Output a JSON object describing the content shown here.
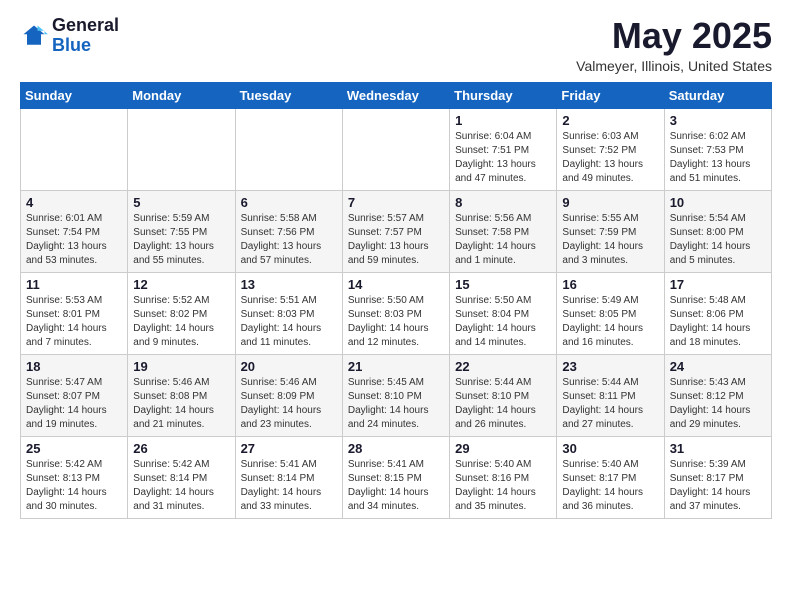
{
  "logo": {
    "general": "General",
    "blue": "Blue"
  },
  "title": "May 2025",
  "location": "Valmeyer, Illinois, United States",
  "days_header": [
    "Sunday",
    "Monday",
    "Tuesday",
    "Wednesday",
    "Thursday",
    "Friday",
    "Saturday"
  ],
  "weeks": [
    [
      {
        "num": "",
        "sunrise": "",
        "sunset": "",
        "daylight": ""
      },
      {
        "num": "",
        "sunrise": "",
        "sunset": "",
        "daylight": ""
      },
      {
        "num": "",
        "sunrise": "",
        "sunset": "",
        "daylight": ""
      },
      {
        "num": "",
        "sunrise": "",
        "sunset": "",
        "daylight": ""
      },
      {
        "num": "1",
        "sunrise": "Sunrise: 6:04 AM",
        "sunset": "Sunset: 7:51 PM",
        "daylight": "Daylight: 13 hours and 47 minutes."
      },
      {
        "num": "2",
        "sunrise": "Sunrise: 6:03 AM",
        "sunset": "Sunset: 7:52 PM",
        "daylight": "Daylight: 13 hours and 49 minutes."
      },
      {
        "num": "3",
        "sunrise": "Sunrise: 6:02 AM",
        "sunset": "Sunset: 7:53 PM",
        "daylight": "Daylight: 13 hours and 51 minutes."
      }
    ],
    [
      {
        "num": "4",
        "sunrise": "Sunrise: 6:01 AM",
        "sunset": "Sunset: 7:54 PM",
        "daylight": "Daylight: 13 hours and 53 minutes."
      },
      {
        "num": "5",
        "sunrise": "Sunrise: 5:59 AM",
        "sunset": "Sunset: 7:55 PM",
        "daylight": "Daylight: 13 hours and 55 minutes."
      },
      {
        "num": "6",
        "sunrise": "Sunrise: 5:58 AM",
        "sunset": "Sunset: 7:56 PM",
        "daylight": "Daylight: 13 hours and 57 minutes."
      },
      {
        "num": "7",
        "sunrise": "Sunrise: 5:57 AM",
        "sunset": "Sunset: 7:57 PM",
        "daylight": "Daylight: 13 hours and 59 minutes."
      },
      {
        "num": "8",
        "sunrise": "Sunrise: 5:56 AM",
        "sunset": "Sunset: 7:58 PM",
        "daylight": "Daylight: 14 hours and 1 minute."
      },
      {
        "num": "9",
        "sunrise": "Sunrise: 5:55 AM",
        "sunset": "Sunset: 7:59 PM",
        "daylight": "Daylight: 14 hours and 3 minutes."
      },
      {
        "num": "10",
        "sunrise": "Sunrise: 5:54 AM",
        "sunset": "Sunset: 8:00 PM",
        "daylight": "Daylight: 14 hours and 5 minutes."
      }
    ],
    [
      {
        "num": "11",
        "sunrise": "Sunrise: 5:53 AM",
        "sunset": "Sunset: 8:01 PM",
        "daylight": "Daylight: 14 hours and 7 minutes."
      },
      {
        "num": "12",
        "sunrise": "Sunrise: 5:52 AM",
        "sunset": "Sunset: 8:02 PM",
        "daylight": "Daylight: 14 hours and 9 minutes."
      },
      {
        "num": "13",
        "sunrise": "Sunrise: 5:51 AM",
        "sunset": "Sunset: 8:03 PM",
        "daylight": "Daylight: 14 hours and 11 minutes."
      },
      {
        "num": "14",
        "sunrise": "Sunrise: 5:50 AM",
        "sunset": "Sunset: 8:03 PM",
        "daylight": "Daylight: 14 hours and 12 minutes."
      },
      {
        "num": "15",
        "sunrise": "Sunrise: 5:50 AM",
        "sunset": "Sunset: 8:04 PM",
        "daylight": "Daylight: 14 hours and 14 minutes."
      },
      {
        "num": "16",
        "sunrise": "Sunrise: 5:49 AM",
        "sunset": "Sunset: 8:05 PM",
        "daylight": "Daylight: 14 hours and 16 minutes."
      },
      {
        "num": "17",
        "sunrise": "Sunrise: 5:48 AM",
        "sunset": "Sunset: 8:06 PM",
        "daylight": "Daylight: 14 hours and 18 minutes."
      }
    ],
    [
      {
        "num": "18",
        "sunrise": "Sunrise: 5:47 AM",
        "sunset": "Sunset: 8:07 PM",
        "daylight": "Daylight: 14 hours and 19 minutes."
      },
      {
        "num": "19",
        "sunrise": "Sunrise: 5:46 AM",
        "sunset": "Sunset: 8:08 PM",
        "daylight": "Daylight: 14 hours and 21 minutes."
      },
      {
        "num": "20",
        "sunrise": "Sunrise: 5:46 AM",
        "sunset": "Sunset: 8:09 PM",
        "daylight": "Daylight: 14 hours and 23 minutes."
      },
      {
        "num": "21",
        "sunrise": "Sunrise: 5:45 AM",
        "sunset": "Sunset: 8:10 PM",
        "daylight": "Daylight: 14 hours and 24 minutes."
      },
      {
        "num": "22",
        "sunrise": "Sunrise: 5:44 AM",
        "sunset": "Sunset: 8:10 PM",
        "daylight": "Daylight: 14 hours and 26 minutes."
      },
      {
        "num": "23",
        "sunrise": "Sunrise: 5:44 AM",
        "sunset": "Sunset: 8:11 PM",
        "daylight": "Daylight: 14 hours and 27 minutes."
      },
      {
        "num": "24",
        "sunrise": "Sunrise: 5:43 AM",
        "sunset": "Sunset: 8:12 PM",
        "daylight": "Daylight: 14 hours and 29 minutes."
      }
    ],
    [
      {
        "num": "25",
        "sunrise": "Sunrise: 5:42 AM",
        "sunset": "Sunset: 8:13 PM",
        "daylight": "Daylight: 14 hours and 30 minutes."
      },
      {
        "num": "26",
        "sunrise": "Sunrise: 5:42 AM",
        "sunset": "Sunset: 8:14 PM",
        "daylight": "Daylight: 14 hours and 31 minutes."
      },
      {
        "num": "27",
        "sunrise": "Sunrise: 5:41 AM",
        "sunset": "Sunset: 8:14 PM",
        "daylight": "Daylight: 14 hours and 33 minutes."
      },
      {
        "num": "28",
        "sunrise": "Sunrise: 5:41 AM",
        "sunset": "Sunset: 8:15 PM",
        "daylight": "Daylight: 14 hours and 34 minutes."
      },
      {
        "num": "29",
        "sunrise": "Sunrise: 5:40 AM",
        "sunset": "Sunset: 8:16 PM",
        "daylight": "Daylight: 14 hours and 35 minutes."
      },
      {
        "num": "30",
        "sunrise": "Sunrise: 5:40 AM",
        "sunset": "Sunset: 8:17 PM",
        "daylight": "Daylight: 14 hours and 36 minutes."
      },
      {
        "num": "31",
        "sunrise": "Sunrise: 5:39 AM",
        "sunset": "Sunset: 8:17 PM",
        "daylight": "Daylight: 14 hours and 37 minutes."
      }
    ]
  ]
}
